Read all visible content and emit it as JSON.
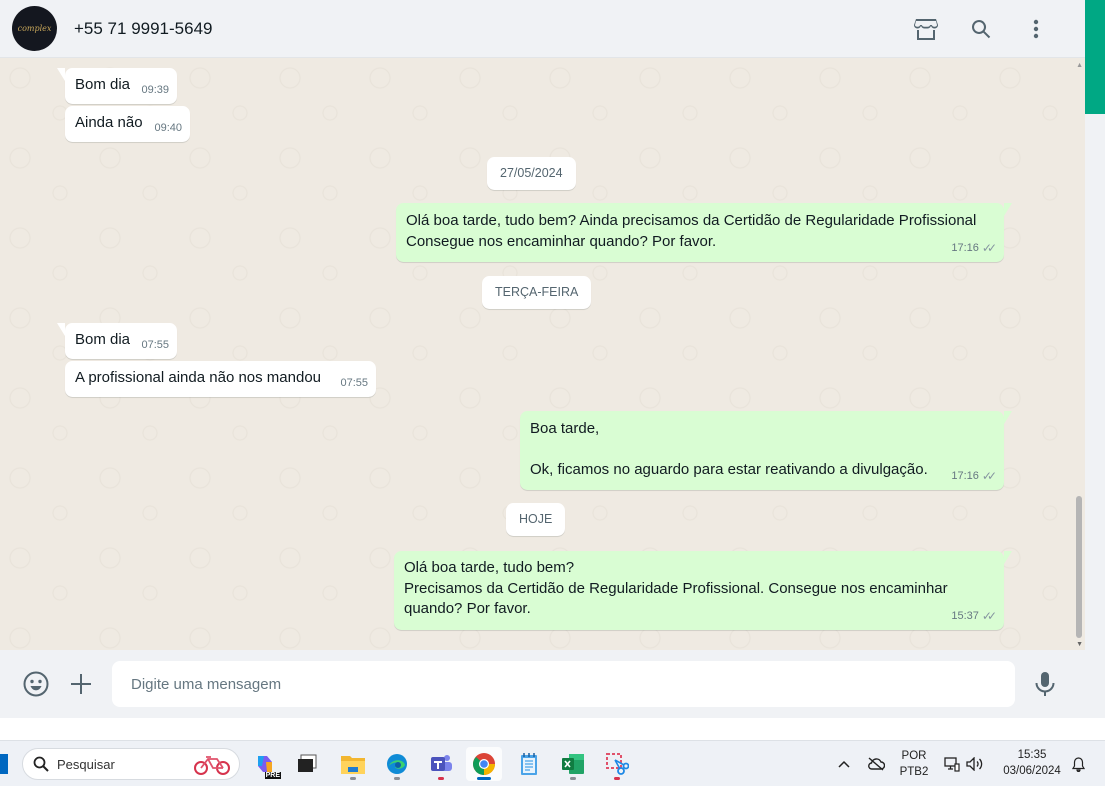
{
  "header": {
    "avatar_text": "complex",
    "contact_name": "+55 71 9991-5649",
    "icons": [
      "shop-icon",
      "search-icon",
      "more-vertical-icon"
    ]
  },
  "messages": [
    {
      "dir": "in",
      "text": "Bom dia",
      "time": "09:39"
    },
    {
      "dir": "in",
      "text": "Ainda não",
      "time": "09:40"
    },
    {
      "dir": "date",
      "text": "27/05/2024"
    },
    {
      "dir": "out",
      "lines": [
        "Olá boa tarde, tudo bem?  Ainda precisamos da Certidão de Regularidade Profissional",
        "Consegue nos encaminhar quando? Por favor."
      ],
      "time": "17:16"
    },
    {
      "dir": "date",
      "text": "TERÇA-FEIRA"
    },
    {
      "dir": "in",
      "text": "Bom dia",
      "time": "07:55"
    },
    {
      "dir": "in",
      "text": "A profissional ainda não nos mandou",
      "time": "07:55"
    },
    {
      "dir": "out",
      "lines": [
        "Boa tarde,",
        "",
        "Ok, ficamos no aguardo para estar reativando a divulgação."
      ],
      "time": "17:16"
    },
    {
      "dir": "date",
      "text": "HOJE"
    },
    {
      "dir": "out",
      "lines": [
        "Olá boa tarde, tudo bem?",
        "Precisamos da Certidão de Regularidade Profissional. Consegue nos encaminhar",
        "quando? Por favor."
      ],
      "time": "15:37"
    }
  ],
  "composer": {
    "placeholder": "Digite uma mensagem",
    "icons": [
      "emoji-icon",
      "plus-icon",
      "microphone-icon"
    ]
  },
  "taskbar": {
    "search_label": "Pesquisar",
    "apps": [
      "copilot-icon",
      "task-view-icon",
      "file-explorer-icon",
      "edge-icon",
      "teams-icon",
      "chrome-icon",
      "notepad-icon",
      "excel-icon",
      "snipping-tool-icon"
    ],
    "active_app": "chrome-icon",
    "language_top": "POR",
    "language_bottom": "PTB2",
    "time": "15:35",
    "date": "03/06/2024"
  }
}
